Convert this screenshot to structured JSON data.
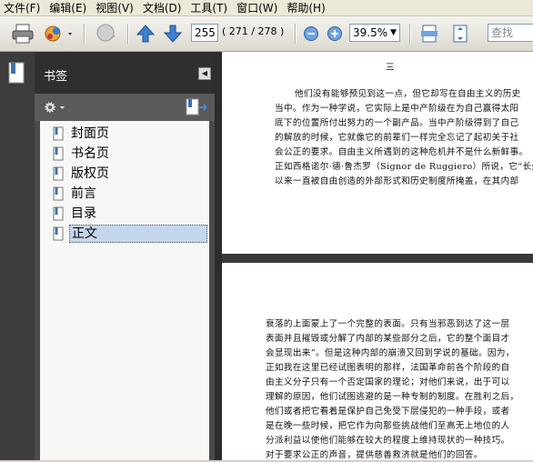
{
  "menu": [
    "文件(F)",
    "编辑(E)",
    "视图(V)",
    "文档(D)",
    "工具(T)",
    "窗口(W)",
    "帮助(H)"
  ],
  "toolbar": {
    "page_current": "255",
    "page_total": "( 271 / 278 )",
    "zoom": "39.5%",
    "search_placeholder": "查找"
  },
  "panel": {
    "title": "书签",
    "bookmarks": [
      {
        "label": "封面页"
      },
      {
        "label": "书名页"
      },
      {
        "label": "版权页"
      },
      {
        "label": "前言"
      },
      {
        "label": "目录"
      },
      {
        "label": "正文"
      }
    ],
    "selected_index": 5
  },
  "document": {
    "page1_header": "三",
    "page1_lines": [
      "他们没有能够预见到这一点，但它却写在自由主义的历史",
      "当中。作为一种学说，它实际上是中产阶级在为自己赢得太阳",
      "底下的位置所付出努力的一个副产品。当中产阶级得到了自己",
      "的解放的时候，它就像它的前辈们一样完全忘记了起初关于社",
      "会公正的要求。自由主义所遇到的这种危机并不是什么新鲜事。",
      "正如西格诺尔·德·鲁杰罗（Signor de Ruggiero）所说，它“长久",
      "以来一直被自由创造的外部形式和历史制度所掩盖，在其内部"
    ],
    "page2_lines": [
      "衰落的上面蒙上了一个完整的表面。只有当邪恶到达了这一层",
      "表面并且摧毁或分解了内部的某些部分之后，它的整个面目才",
      "会显现出来”。但是这种内部的崩溃又回到学说的基础。因为，",
      "正如我在这里已经试图表明的那样，法国革命前各个阶段的自",
      "由主义分子只有一个否定国家的理论；对他们来说，出于可以",
      "理解的原因，他们试图逃避的是一种专制的制度。在胜利之后，",
      "他们或者把它看着是保护自己免受下层侵犯的一种手段，或者",
      "是在晚一些时候，把它作为向那些挑战他们至高无上地位的人",
      "分派利益以使他们能够在较大的程度上维持现状的一种技巧。",
      "对于要求公正的声音，提供慈善救济就是他们的回答。"
    ]
  }
}
